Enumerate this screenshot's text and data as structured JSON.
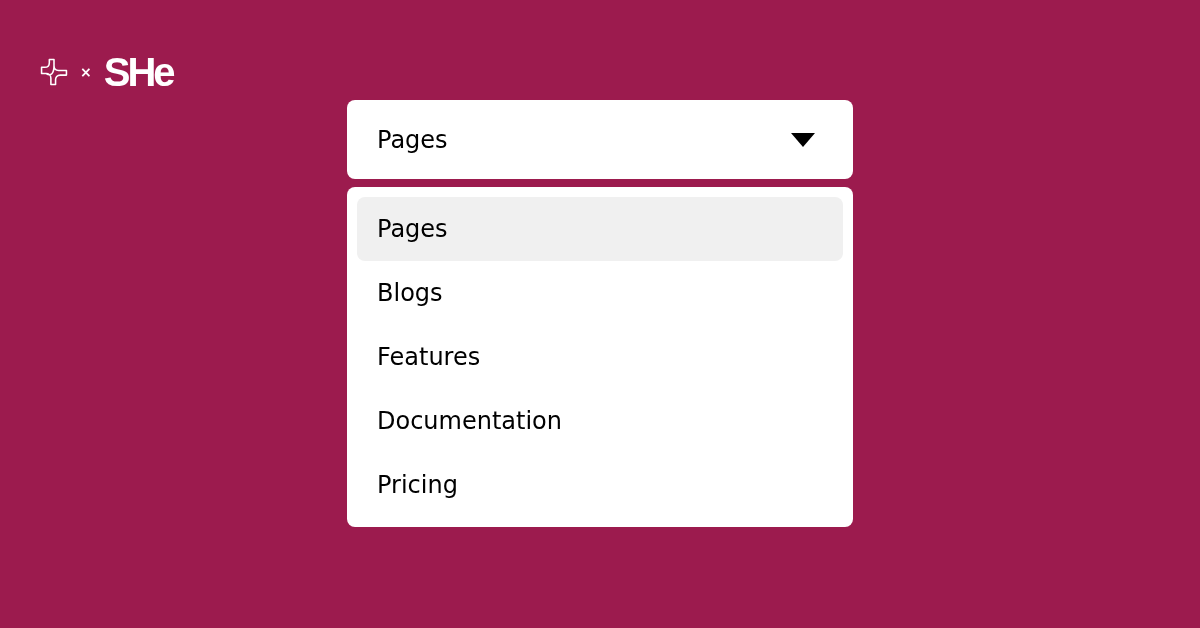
{
  "logo": {
    "separator": "×",
    "brand": "SHe"
  },
  "select": {
    "value": "Pages",
    "expanded": true
  },
  "menu": [
    {
      "label": "Pages",
      "selected": true
    },
    {
      "label": "Blogs",
      "selected": false
    },
    {
      "label": "Features",
      "selected": false
    },
    {
      "label": "Documentation",
      "selected": false
    },
    {
      "label": "Pricing",
      "selected": false
    }
  ]
}
